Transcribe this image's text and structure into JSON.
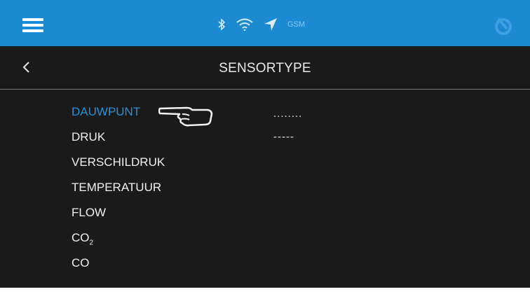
{
  "header": {
    "status_icons": [
      "bluetooth-icon",
      "wifi-icon",
      "location-arrow-icon"
    ],
    "gsm_label": "GSM",
    "accent_color": "#1b8ad2"
  },
  "screen": {
    "title": "SENSORTYPE"
  },
  "sensor_list": {
    "items": [
      {
        "label": "DAUWPUNT",
        "selected": true
      },
      {
        "label": "DRUK",
        "selected": false
      },
      {
        "label": "VERSCHILDRUK",
        "selected": false
      },
      {
        "label": "TEMPERATUUR",
        "selected": false
      },
      {
        "label": "FLOW",
        "selected": false
      },
      {
        "label": "CO",
        "subscript": "2",
        "selected": false
      },
      {
        "label": "CO",
        "selected": false
      }
    ]
  },
  "values": [
    "........",
    "-----"
  ]
}
